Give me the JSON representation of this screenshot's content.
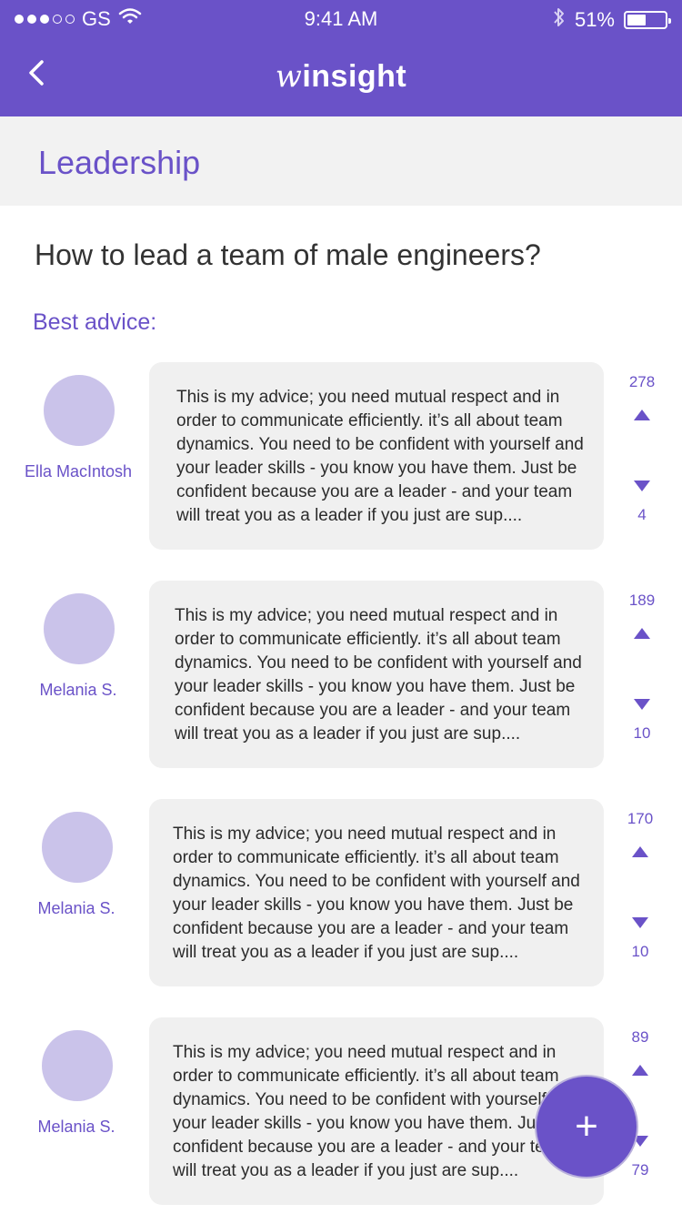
{
  "status_bar": {
    "carrier": "GS",
    "time": "9:41 AM",
    "battery": "51%"
  },
  "nav": {
    "brand_w": "w",
    "brand_rest": "insight"
  },
  "category": {
    "title": "Leadership"
  },
  "question": "How to lead a team of male engineers?",
  "section_label": "Best advice:",
  "advice": [
    {
      "author": "Ella MacIntosh",
      "text": "This is my advice; you need mutual respect and in order to communicate efficiently. it’s all about team dynamics.  You need to be confident with yourself and  your leader skills - you know you have them. Just be confident because you are a leader - and your team will treat you as a leader if you just are sup....",
      "upvotes": "278",
      "downvotes": "4"
    },
    {
      "author": "Melania S.",
      "text": "This is my advice; you need mutual respect and in order to communicate efficiently. it’s all about team dynamics.  You need to be confident with yourself and  your leader skills - you know you have them. Just be confident because you are a leader - and your team will treat you as a leader if you just are sup....",
      "upvotes": "189",
      "downvotes": "10"
    },
    {
      "author": "Melania S.",
      "text": "This is my advice; you need mutual respect and in order to communicate efficiently. it’s all about team dynamics.  You need to be confident with yourself and  your leader skills - you know you have them. Just be confident because you are a leader - and your team will treat you as a leader if you just are sup....",
      "upvotes": "170",
      "downvotes": "10"
    },
    {
      "author": "Melania S.",
      "text": "This is my advice; you need mutual respect and in order to communicate efficiently. it’s all about team dynamics.  You need to be confident with yourself and  your leader skills - you know you have them. Just be confident because you are a leader - and your team will treat you as a leader if you just are sup....",
      "upvotes": "89",
      "downvotes": "79"
    }
  ],
  "fab": {
    "label": "+"
  },
  "colors": {
    "brand": "#6a52c8",
    "avatar": "#cac3ea",
    "bubble": "#f0f0f0",
    "category_bg": "#f2f2f2"
  }
}
